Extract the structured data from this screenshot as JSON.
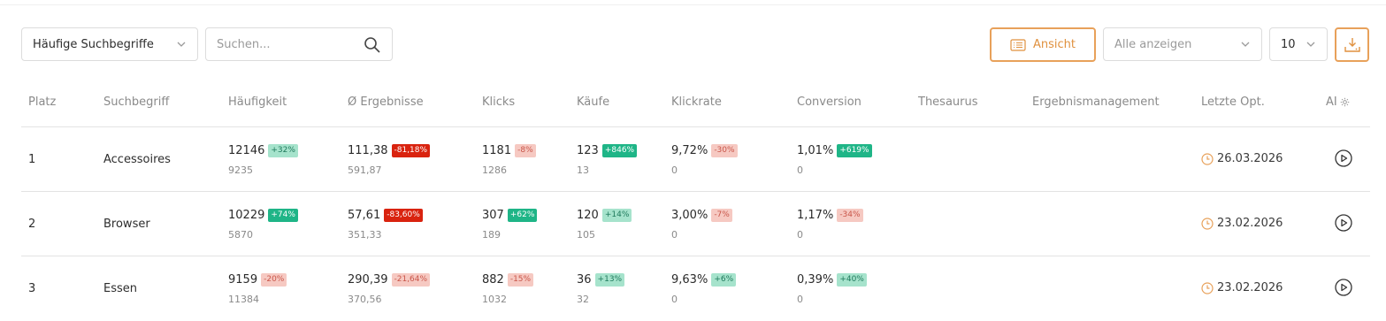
{
  "toolbar": {
    "report_select": "Häufige Suchbegriffe",
    "search_placeholder": "Suchen...",
    "view_button": "Ansicht",
    "filter_select": "Alle anzeigen",
    "page_size": "10"
  },
  "columns": [
    "Platz",
    "Suchbegriff",
    "Häufigkeit",
    "Ø Ergebnisse",
    "Klicks",
    "Käufe",
    "Klickrate",
    "Conversion",
    "Thesaurus",
    "Ergebnismanagement",
    "Letzte Opt.",
    "AI"
  ],
  "colors": {
    "accent": "#e8a15a",
    "up_strong": "#1fb587",
    "up_light": "#a6e3cc",
    "down_strong": "#d9230f",
    "down_light": "#f6c9c2"
  },
  "rows": [
    {
      "platz": "1",
      "term": "Accessoires",
      "haeufigkeit": "12146",
      "haeufigkeit_badge": "+32%",
      "haeufigkeit_prev": "9235",
      "ergebnisse": "111,38",
      "ergebnisse_badge": "-81,18%",
      "ergebnisse_prev": "591,87",
      "klicks": "1181",
      "klicks_badge": "-8%",
      "klicks_prev": "1286",
      "kaeufe": "123",
      "kaeufe_badge": "+846%",
      "kaeufe_prev": "13",
      "klickrate": "9,72%",
      "klickrate_badge": "-30%",
      "klickrate_prev": "0",
      "conversion": "1,01%",
      "conversion_badge": "+619%",
      "conversion_prev": "0",
      "letzte_opt": "26.03.2026"
    },
    {
      "platz": "2",
      "term": "Browser",
      "haeufigkeit": "10229",
      "haeufigkeit_badge": "+74%",
      "haeufigkeit_prev": "5870",
      "ergebnisse": "57,61",
      "ergebnisse_badge": "-83,60%",
      "ergebnisse_prev": "351,33",
      "klicks": "307",
      "klicks_badge": "+62%",
      "klicks_prev": "189",
      "kaeufe": "120",
      "kaeufe_badge": "+14%",
      "kaeufe_prev": "105",
      "klickrate": "3,00%",
      "klickrate_badge": "-7%",
      "klickrate_prev": "0",
      "conversion": "1,17%",
      "conversion_badge": "-34%",
      "conversion_prev": "0",
      "letzte_opt": "23.02.2026"
    },
    {
      "platz": "3",
      "term": "Essen",
      "haeufigkeit": "9159",
      "haeufigkeit_badge": "-20%",
      "haeufigkeit_prev": "11384",
      "ergebnisse": "290,39",
      "ergebnisse_badge": "-21,64%",
      "ergebnisse_prev": "370,56",
      "klicks": "882",
      "klicks_badge": "-15%",
      "klicks_prev": "1032",
      "kaeufe": "36",
      "kaeufe_badge": "+13%",
      "kaeufe_prev": "32",
      "klickrate": "9,63%",
      "klickrate_badge": "+6%",
      "klickrate_prev": "0",
      "conversion": "0,39%",
      "conversion_badge": "+40%",
      "conversion_prev": "0",
      "letzte_opt": "23.02.2026"
    }
  ]
}
